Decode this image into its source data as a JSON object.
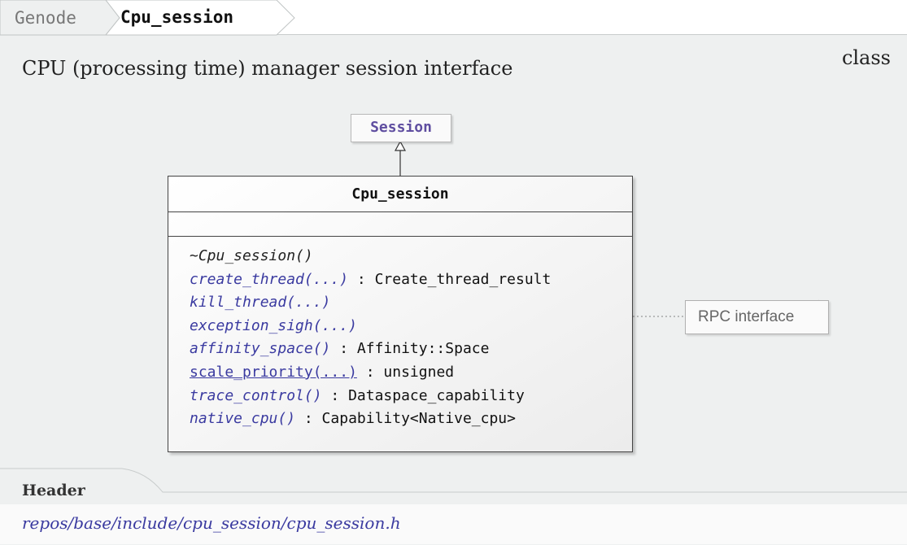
{
  "breadcrumb": {
    "parent": "Genode",
    "current": "Cpu_session"
  },
  "description": "CPU (processing time) manager session interface",
  "kind": "class",
  "diagram": {
    "base_class": "Session",
    "class_name": "Cpu_session",
    "methods": [
      {
        "name": "~Cpu_session()",
        "ret": "",
        "style": "dtor"
      },
      {
        "name": "create_thread(...)",
        "ret": " : Create_thread_result",
        "style": "rpc"
      },
      {
        "name": "kill_thread(...)",
        "ret": "",
        "style": "rpc"
      },
      {
        "name": "exception_sigh(...)",
        "ret": "",
        "style": "rpc"
      },
      {
        "name": "affinity_space()",
        "ret": " : Affinity::Space",
        "style": "rpc"
      },
      {
        "name": "scale_priority(...)",
        "ret": " : unsigned",
        "style": "static"
      },
      {
        "name": "trace_control()",
        "ret": " : Dataspace_capability",
        "style": "rpc"
      },
      {
        "name": "native_cpu()",
        "ret": " : Capability<Native_cpu>",
        "style": "rpc"
      }
    ],
    "note": "RPC interface"
  },
  "header": {
    "label": "Header",
    "path": "repos/base/include/cpu_session/cpu_session.h"
  },
  "colors": {
    "panel": "#eef0f0",
    "link": "#3a3aa0",
    "base_class": "#5f4ea0"
  }
}
